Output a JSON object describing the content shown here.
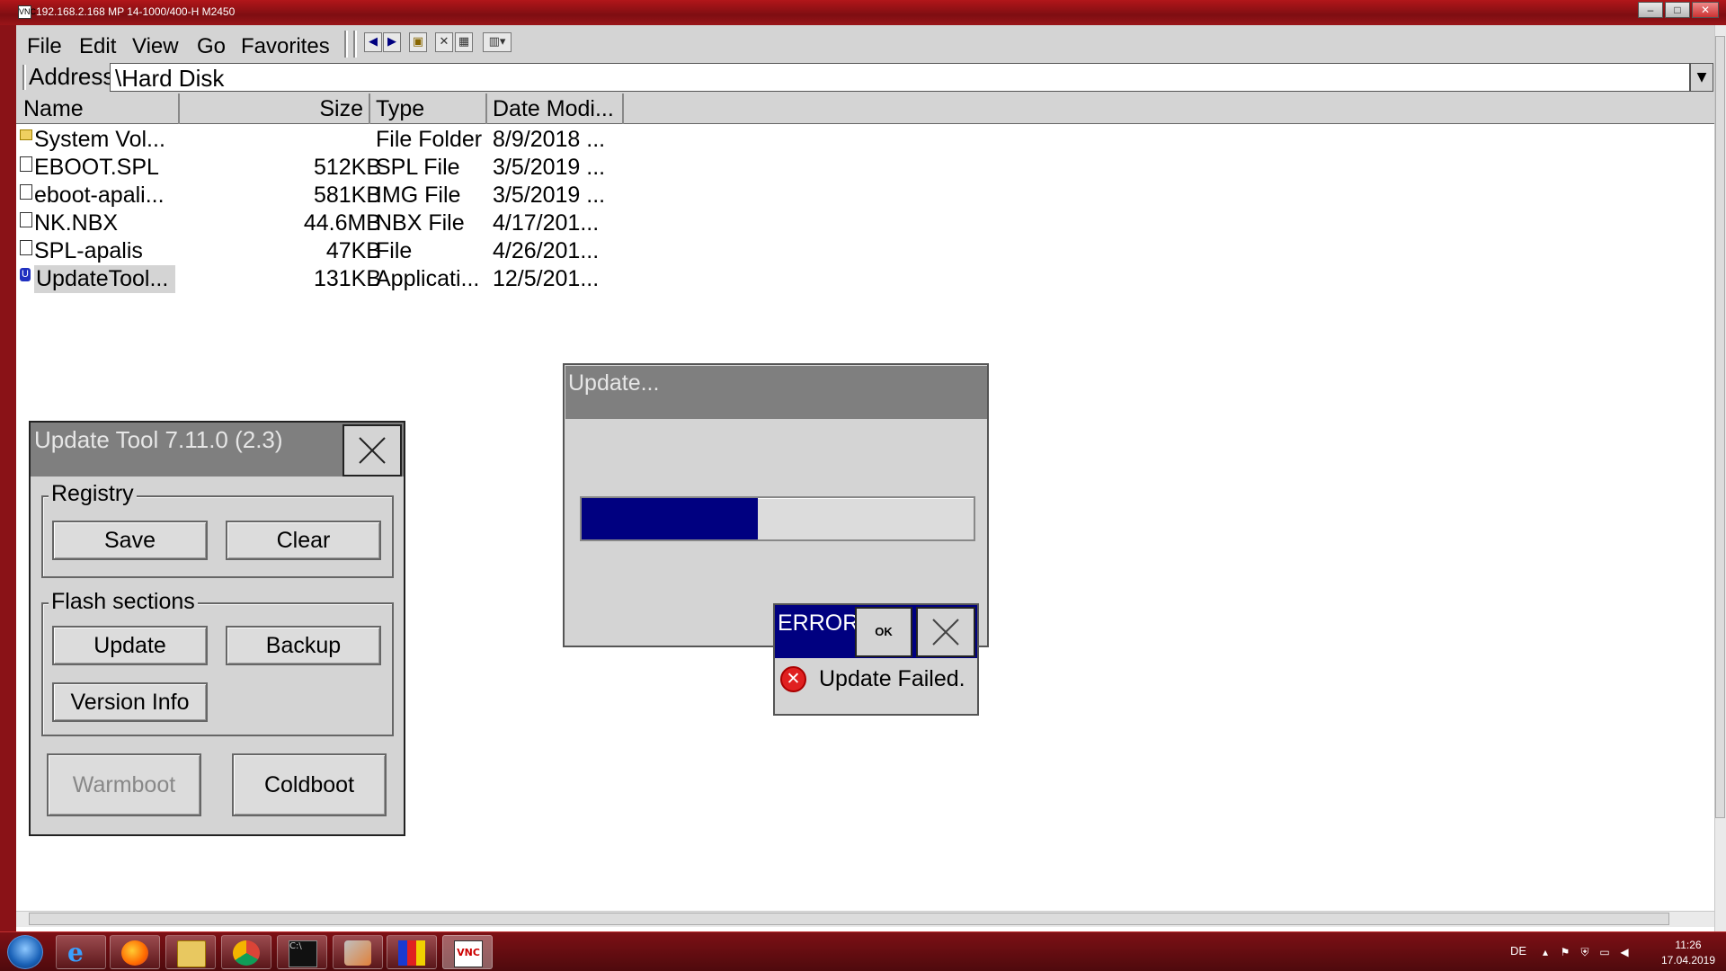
{
  "vnc": {
    "title": "192.168.2.168    MP 14-1000/400-H    M2450",
    "app_icon": "VNC",
    "min": "–",
    "max": "□",
    "close": "✕"
  },
  "explorer": {
    "menu": [
      "File",
      "Edit",
      "View",
      "Go",
      "Favorites"
    ],
    "address_label": "Address",
    "address_value": "\\Hard Disk",
    "columns": [
      "Name",
      "Size",
      "Type",
      "Date Modi..."
    ],
    "files": [
      {
        "name": "System Vol...",
        "size": "",
        "type": "File Folder",
        "date": "8/9/2018 ...",
        "icon": "folder-icon"
      },
      {
        "name": "EBOOT.SPL",
        "size": "512KB",
        "type": "SPL File",
        "date": "3/5/2019 ...",
        "icon": "file-icon"
      },
      {
        "name": "eboot-apali...",
        "size": "581KB",
        "type": "IMG File",
        "date": "3/5/2019 ...",
        "icon": "file-icon"
      },
      {
        "name": "NK.NBX",
        "size": "44.6MB",
        "type": "NBX File",
        "date": "4/17/201...",
        "icon": "file-icon"
      },
      {
        "name": "SPL-apalis",
        "size": "47KB",
        "type": "File",
        "date": "4/26/201...",
        "icon": "file-icon"
      },
      {
        "name": "UpdateTool...",
        "size": "131KB",
        "type": "Applicati...",
        "date": "12/5/201...",
        "icon": "update-tool-icon",
        "selected": true
      }
    ]
  },
  "update_tool": {
    "title": "Update Tool 7.11.0 (2.3)",
    "registry_label": "Registry",
    "save": "Save",
    "clear": "Clear",
    "flash_label": "Flash sections",
    "update": "Update",
    "backup": "Backup",
    "version_info": "Version Info",
    "warmboot": "Warmboot",
    "coldboot": "Coldboot"
  },
  "update_dialog": {
    "title": "Update...",
    "progress": 0.45
  },
  "error_dialog": {
    "title": "ERROR",
    "ok": "OK",
    "message": "Update Failed."
  },
  "taskbar": {
    "lang": "DE",
    "time": "11:26",
    "date": "17.04.2019"
  }
}
